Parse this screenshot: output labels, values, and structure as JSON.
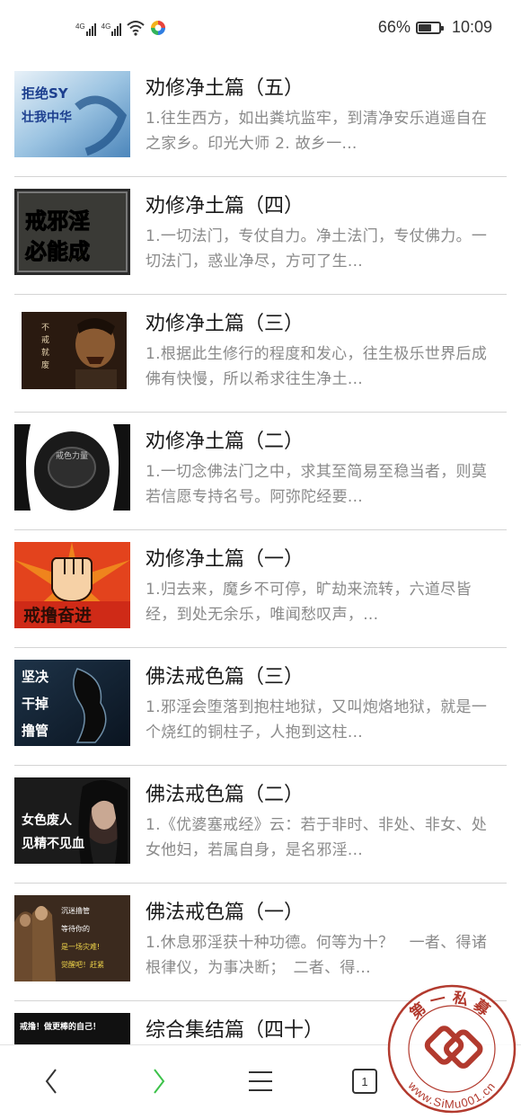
{
  "status_bar": {
    "network_1": "4G",
    "network_2": "4G",
    "battery_percent": "66%",
    "battery_level": 0.66,
    "time": "10:09"
  },
  "articles": [
    {
      "title": "劝修净土篇（五）",
      "summary": "1.往生西方，如出粪坑监牢，到清净安乐逍遥自在之家乡。印光大师 2. 故乡一...",
      "thumb_text": [
        "拒绝SY",
        "壮我中华"
      ]
    },
    {
      "title": "劝修净土篇（四）",
      "summary": "1.一切法门，专仗自力。净土法门，专仗佛力。一切法门，惑业净尽，方可了生...",
      "thumb_text": [
        "戒邪淫",
        "必能成"
      ]
    },
    {
      "title": "劝修净土篇（三）",
      "summary": "1.根据此生修行的程度和发心，往生极乐世界后成佛有快慢，所以希求往生净土...",
      "thumb_text": [
        "不",
        "戒",
        "就",
        "废"
      ]
    },
    {
      "title": "劝修净土篇（二）",
      "summary": "1.一切念佛法门之中，求其至简易至稳当者，则莫若信愿专持名号。阿弥陀经要...",
      "thumb_text": [
        "戒色力量"
      ]
    },
    {
      "title": "劝修净土篇（一）",
      "summary": "1.归去来，魔乡不可停，旷劫来流转，六道尽皆经，到处无余乐，唯闻愁叹声，...",
      "thumb_text": [
        "戒撸奋进"
      ]
    },
    {
      "title": "佛法戒色篇（三）",
      "summary": "1.邪淫会堕落到抱柱地狱，又叫炮烙地狱，就是一个烧红的铜柱子，人抱到这柱...",
      "thumb_text": [
        "坚决",
        "干掉",
        "撸管"
      ]
    },
    {
      "title": "佛法戒色篇（二）",
      "summary": "1.《优婆塞戒经》云：若于非时、非处、非女、处女他妇，若属自身，是名邪淫...",
      "thumb_text": [
        "女色废人",
        "见精不见血"
      ]
    },
    {
      "title": "佛法戒色篇（一）",
      "summary": "1.休息邪淫获十种功德。何等为十？　一者、得诸根律仪，为事决断；　二者、得...",
      "thumb_text": [
        "沉迷撸管",
        "等待你的",
        "是一场灾难!",
        "觉醒吧！赶紧"
      ]
    },
    {
      "title": "综合集结篇（四十）",
      "summary": "",
      "thumb_text": [
        "戒撸！做更棒的自己！"
      ]
    }
  ],
  "bottom_nav": {
    "tab_count": "1"
  },
  "watermark": {
    "text_top": "第一私募",
    "text_url": "www.SiMu001.cn"
  },
  "colors": {
    "forward_arrow": "#3cc24a",
    "title": "#1a1a1a",
    "summary": "#8a8a8a",
    "divider": "#d4d4d4",
    "watermark": "#b23a2e"
  }
}
